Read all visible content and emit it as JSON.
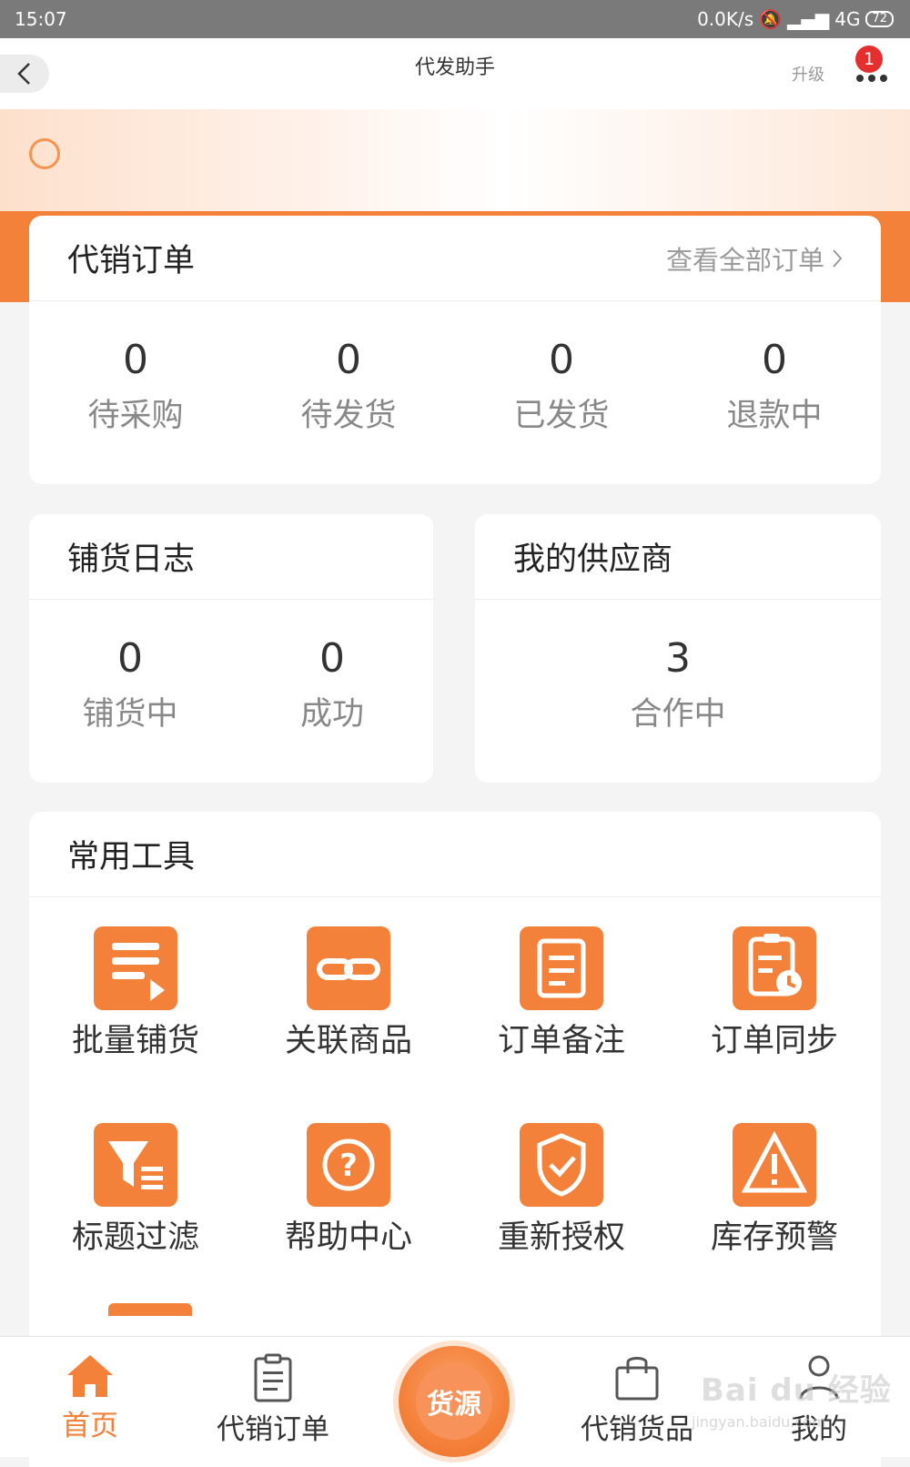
{
  "status_bar": {
    "time": "15:07",
    "network_speed": "0.0K/s",
    "signal": "4G",
    "battery": "72"
  },
  "top_bar": {
    "title": "代发助手",
    "upgrade_label": "升级",
    "notification_count": "1"
  },
  "colors": {
    "accent": "#f4813a",
    "badge": "#e52e2e"
  },
  "orders": {
    "title": "代销订单",
    "view_all": "查看全部订单",
    "stats": [
      {
        "value": "0",
        "label": "待采购"
      },
      {
        "value": "0",
        "label": "待发货"
      },
      {
        "value": "0",
        "label": "已发货"
      },
      {
        "value": "0",
        "label": "退款中"
      }
    ]
  },
  "distribution_log": {
    "title": "铺货日志",
    "stats": [
      {
        "value": "0",
        "label": "铺货中"
      },
      {
        "value": "0",
        "label": "成功"
      }
    ]
  },
  "suppliers": {
    "title": "我的供应商",
    "stats": [
      {
        "value": "3",
        "label": "合作中"
      }
    ]
  },
  "tools": {
    "title": "常用工具",
    "items": [
      {
        "label": "批量铺货",
        "icon": "batch-distribute-icon"
      },
      {
        "label": "关联商品",
        "icon": "link-product-icon"
      },
      {
        "label": "订单备注",
        "icon": "order-note-icon"
      },
      {
        "label": "订单同步",
        "icon": "order-sync-icon"
      },
      {
        "label": "标题过滤",
        "icon": "title-filter-icon"
      },
      {
        "label": "帮助中心",
        "icon": "help-center-icon"
      },
      {
        "label": "重新授权",
        "icon": "reauthorize-icon"
      },
      {
        "label": "库存预警",
        "icon": "stock-alert-icon"
      }
    ]
  },
  "tab_bar": {
    "items": [
      {
        "label": "首页",
        "icon": "home-icon",
        "active": true
      },
      {
        "label": "代销订单",
        "icon": "clipboard-icon",
        "active": false
      },
      {
        "label": "货源",
        "icon": "source-icon",
        "active": false
      },
      {
        "label": "代销货品",
        "icon": "shopping-bag-icon",
        "active": false
      },
      {
        "label": "我的",
        "icon": "user-icon",
        "active": false
      }
    ]
  },
  "watermark": {
    "text": "Bai du 经验",
    "sub": "jingyan.baidu.com"
  }
}
